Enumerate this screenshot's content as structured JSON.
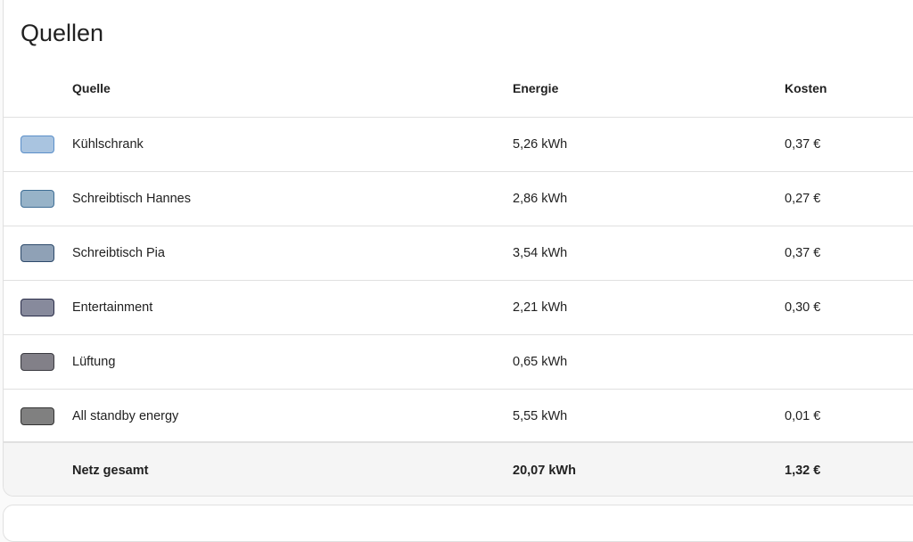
{
  "title": "Quellen",
  "columns": {
    "source": "Quelle",
    "energy": "Energie",
    "cost": "Kosten"
  },
  "rows": [
    {
      "name": "Kühlschrank",
      "energy": "5,26 kWh",
      "cost": "0,37 €",
      "fill": "#a9c4e0",
      "border": "#5b8fc9"
    },
    {
      "name": "Schreibtisch Hannes",
      "energy": "2,86 kWh",
      "cost": "0,27 €",
      "fill": "#97b3c8",
      "border": "#3f6e95"
    },
    {
      "name": "Schreibtisch Pia",
      "energy": "3,54 kWh",
      "cost": "0,37 €",
      "fill": "#8fa1b6",
      "border": "#2d4a6b"
    },
    {
      "name": "Entertainment",
      "energy": "2,21 kWh",
      "cost": "0,30 €",
      "fill": "#878a9c",
      "border": "#2b2e4a"
    },
    {
      "name": "Lüftung",
      "energy": "0,65 kWh",
      "cost": "",
      "fill": "#828088",
      "border": "#3a3a40"
    },
    {
      "name": "All standby energy",
      "energy": "5,55 kWh",
      "cost": "0,01 €",
      "fill": "#808080",
      "border": "#333333"
    }
  ],
  "total": {
    "label": "Netz gesamt",
    "energy": "20,07 kWh",
    "cost": "1,32 €"
  }
}
